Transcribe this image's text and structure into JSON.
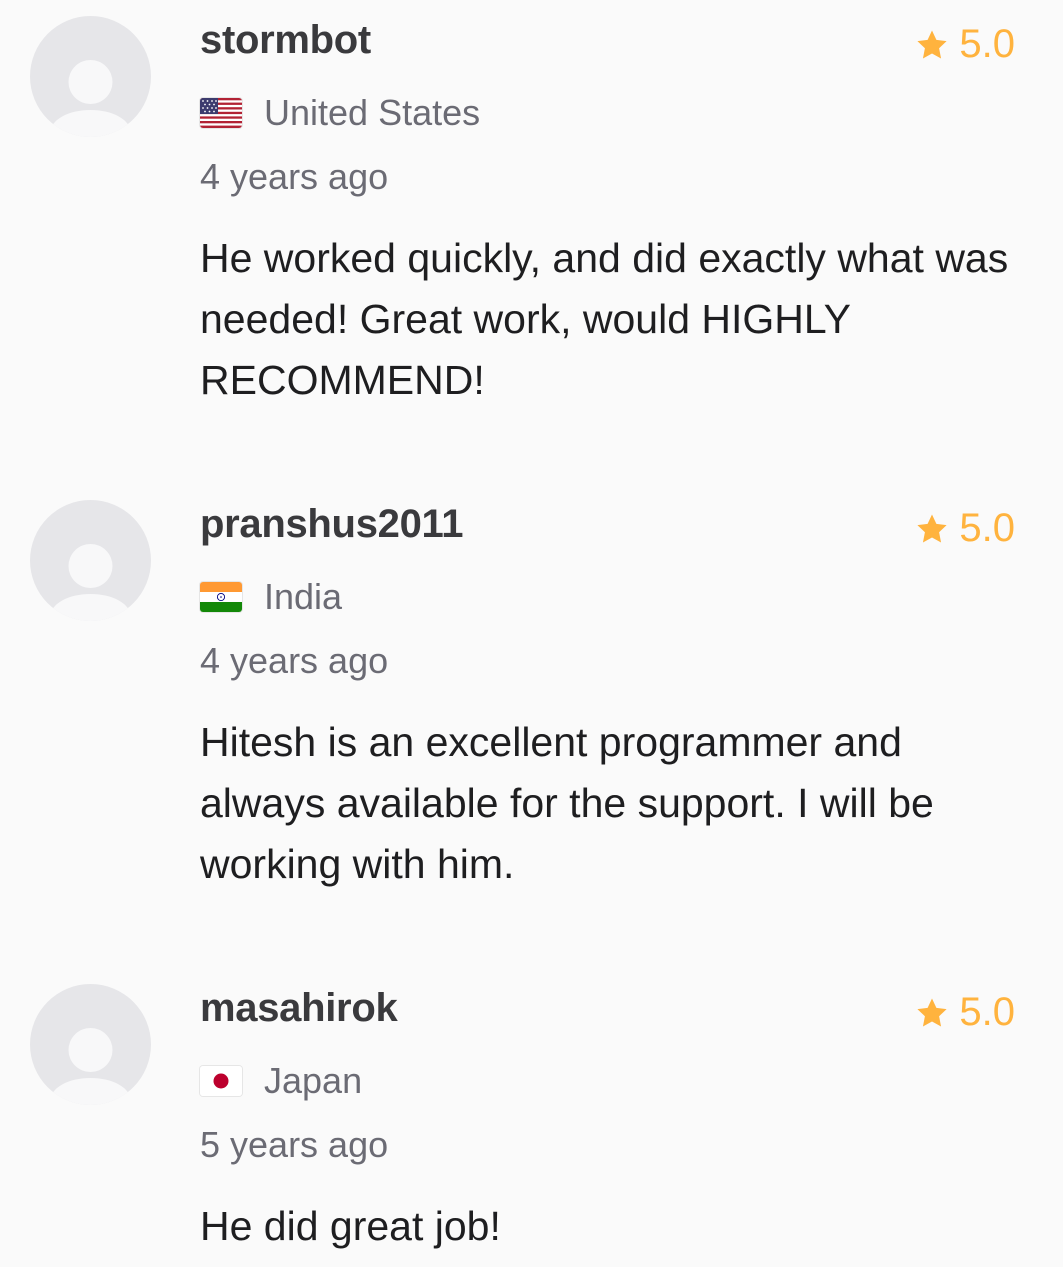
{
  "reviews": [
    {
      "username": "stormbot",
      "rating": "5.0",
      "country": "United States",
      "flag": "us-flag-icon",
      "time": "4 years ago",
      "text": "He worked quickly, and did exactly what was needed! Great work, would HIGHLY RECOMMEND!"
    },
    {
      "username": "pranshus2011",
      "rating": "5.0",
      "country": "India",
      "flag": "india-flag-icon",
      "time": "4 years ago",
      "text": "Hitesh is an excellent programmer and always available for the support. I will be working with him."
    },
    {
      "username": "masahirok",
      "rating": "5.0",
      "country": "Japan",
      "flag": "japan-flag-icon",
      "time": "5 years ago",
      "text": "He did great job!"
    }
  ],
  "colors": {
    "star": "#ffb33e",
    "avatar_bg": "#e6e6e9",
    "avatar_fg": "#f8f8f9",
    "secondary_text": "#6b6b74",
    "username": "#3a3a3d",
    "body_text": "#1e1e20"
  }
}
